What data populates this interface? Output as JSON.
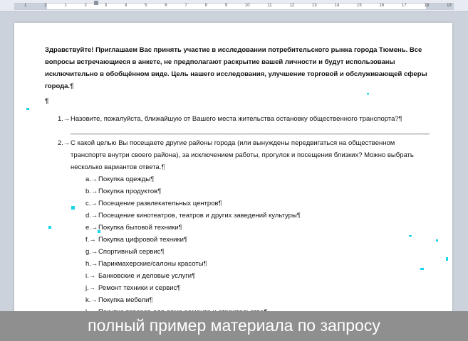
{
  "ruler": {
    "numbers": [
      "1",
      "2",
      "1",
      "2",
      "3",
      "4",
      "5",
      "6",
      "7",
      "8",
      "9",
      "10",
      "11",
      "12",
      "13",
      "14",
      "15",
      "16",
      "17",
      "18",
      "19"
    ]
  },
  "document": {
    "intro": "Здравствуйте! Приглашаем Вас принять участие в исследовании потребительского рынка города Тюмень. Все вопросы встречающиеся в анкете, не предполагают раскрытие вашей личности и будут использованы исключительно в обобщённом виде. Цель нашего исследования, улучшение торговой и обслуживающей сферы города.",
    "pilcrow": "¶",
    "questions": [
      {
        "number": "1.→",
        "text": "Назовите, пожалуйста, ближайшую от Вашего места жительства остановку общественного транспорта?",
        "answer_line": "__________________________________________________________________________________________________________"
      },
      {
        "number": "2.→",
        "text": "С какой целью Вы посещаете другие районы города (или вынуждены передвигаться на общественном транспорте внутри своего района), за исключением работы, прогулок и посещения близких? Можно выбрать несколько вариантов ответа."
      }
    ],
    "options": [
      {
        "letter": "a.→",
        "text": "Покупка одежды"
      },
      {
        "letter": "b.→",
        "text": "Покупка продуктов"
      },
      {
        "letter": "c.→",
        "text": "Посещение развлекательных центров"
      },
      {
        "letter": "d.→",
        "text": "Посещение кинотеатров, театров и других заведений культуры"
      },
      {
        "letter": "e.→",
        "text": "Покупка бытовой техники"
      },
      {
        "letter": "f.→",
        "text": "Покупка цифровой техники"
      },
      {
        "letter": "g.→",
        "text": "Спортивный сервис"
      },
      {
        "letter": "h.→",
        "text": "Парикмахерские/салоны красоты"
      },
      {
        "letter": "i.→",
        "text": "Банковские и деловые услуги"
      },
      {
        "letter": "j.→",
        "text": "Ремонт техники и сервис"
      },
      {
        "letter": "k.→",
        "text": "Покупка мебели"
      },
      {
        "letter": "l.→",
        "text": "Покупка товаров для дома ремонта и строительства"
      }
    ]
  },
  "banner": {
    "text": "полный пример материала по запросу"
  },
  "colors": {
    "banner_bg": "#8f8f8f",
    "speck": "#18d4e8"
  }
}
